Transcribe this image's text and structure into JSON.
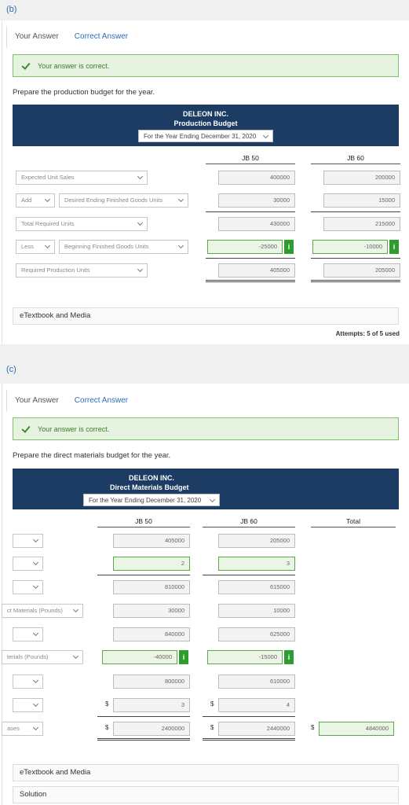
{
  "part_b": {
    "label": "(b)",
    "tabs": {
      "your_answer": "Your Answer",
      "correct_answer": "Correct Answer"
    },
    "status": "Your answer is correct.",
    "prompt": "Prepare the production budget for the year.",
    "banner": {
      "company": "DELEON INC.",
      "title": "Production Budget",
      "period": "For the Year Ending December 31, 2020"
    },
    "columns": [
      "JB 50",
      "JB 60"
    ],
    "rows": [
      {
        "prefix": "",
        "label": "Expected Unit Sales",
        "values": [
          "400000",
          "200000"
        ]
      },
      {
        "prefix": "Add",
        "label": "Desired Ending Finished Goods Units",
        "values": [
          "30000",
          "15000"
        ]
      },
      {
        "prefix": "",
        "label": "Total Required Units",
        "values": [
          "430000",
          "215000"
        ]
      },
      {
        "prefix": "Less",
        "label": "Beginning Finished Goods Units",
        "values": [
          "-25000",
          "-10000"
        ]
      },
      {
        "prefix": "",
        "label": "Required Production Units",
        "values": [
          "405000",
          "205000"
        ]
      }
    ],
    "info_glyph": "i",
    "media": "eTextbook and Media",
    "attempts": "Attempts: 5 of 5 used"
  },
  "part_c": {
    "label": "(c)",
    "tabs": {
      "your_answer": "Your Answer",
      "correct_answer": "Correct Answer"
    },
    "status": "Your answer is correct.",
    "prompt": "Prepare the direct materials budget for the year.",
    "banner": {
      "company": "DELEON INC.",
      "title": "Direct Materials Budget",
      "period": "For the Year Ending December 31, 2020"
    },
    "columns": [
      "JB 50",
      "JB 60",
      "Total"
    ],
    "rows": [
      {
        "label": "",
        "values": [
          "405000",
          "205000",
          ""
        ]
      },
      {
        "label": "",
        "values": [
          "2",
          "3",
          ""
        ]
      },
      {
        "label": "",
        "values": [
          "810000",
          "615000",
          ""
        ]
      },
      {
        "label": "ct Materials (Pounds)",
        "values": [
          "30000",
          "10000",
          ""
        ]
      },
      {
        "label": "",
        "values": [
          "840000",
          "625000",
          ""
        ]
      },
      {
        "label": "terials (Pounds)",
        "values": [
          "-40000",
          "-15000",
          ""
        ]
      },
      {
        "label": "",
        "values": [
          "800000",
          "610000",
          ""
        ]
      },
      {
        "label": "",
        "values": [
          "3",
          "4",
          ""
        ]
      },
      {
        "label": "ases",
        "values": [
          "2400000",
          "2440000",
          "4840000"
        ]
      }
    ],
    "dollar": "$",
    "info_glyph": "i",
    "media": "eTextbook and Media",
    "solution": "Solution"
  }
}
